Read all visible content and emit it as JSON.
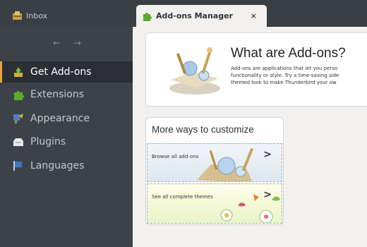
{
  "tabs": {
    "inbox": {
      "label": "Inbox",
      "icon": "inbox-icon"
    },
    "addons": {
      "label": "Add-ons Manager",
      "icon": "puzzle-icon",
      "close": "×"
    }
  },
  "sidebar": {
    "nav_arrows": "← →",
    "items": [
      {
        "label": "Get Add-ons",
        "icon": "get-addons-icon",
        "selected": true
      },
      {
        "label": "Extensions",
        "icon": "puzzle-icon"
      },
      {
        "label": "Appearance",
        "icon": "brush-icon"
      },
      {
        "label": "Plugins",
        "icon": "plugin-block-icon"
      },
      {
        "label": "Languages",
        "icon": "flag-icon"
      }
    ]
  },
  "hero": {
    "title": "What are Add-ons?",
    "body_lines": [
      "Add-ons are applications that let you perso",
      "functionality or style. Try a time-saving side",
      "themed look to make Thunderbird your ow"
    ]
  },
  "more_ways": {
    "title": "More ways to customize",
    "cards": [
      {
        "label": "Browse all add-ons",
        "arrow": ">"
      },
      {
        "label": "See all complete themes",
        "arrow": ">"
      }
    ]
  },
  "colors": {
    "accent": "#e8a33c",
    "sidebar": "#3d4248",
    "content_bg": "#f2f1f0"
  }
}
